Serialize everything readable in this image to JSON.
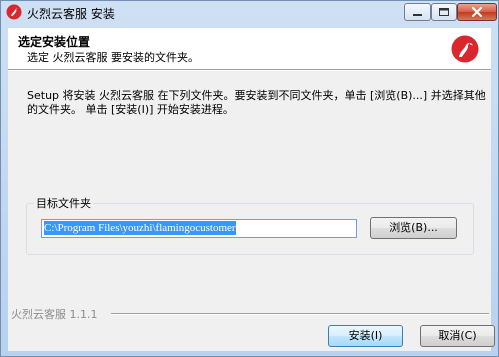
{
  "window": {
    "title": "火烈云客服 安装"
  },
  "header": {
    "title": "选定安装位置",
    "subtitle": "选定 火烈云客服 要安装的文件夹。"
  },
  "main": {
    "description": "Setup 将安装 火烈云客服 在下列文件夹。要安装到不同文件夹，单击 [浏览(B)...] 并选择其他的文件夹。 单击 [安装(I)] 开始安装进程。",
    "group_label": "目标文件夹",
    "install_path": "C:\\Program Files\\youzhi\\flamingocustomer",
    "browse_label": "浏览(B)..."
  },
  "footer": {
    "brand": "火烈云客服 1.1.1",
    "install_label": "安装(I)",
    "cancel_label": "取消(C)"
  },
  "colors": {
    "accent": "#d9272e",
    "selection": "#3399ff",
    "close_button": "#c4391f"
  },
  "icons": {
    "app": "flamingo-logo-icon",
    "minimize": "minimize-icon",
    "maximize": "maximize-icon",
    "close": "close-icon"
  }
}
